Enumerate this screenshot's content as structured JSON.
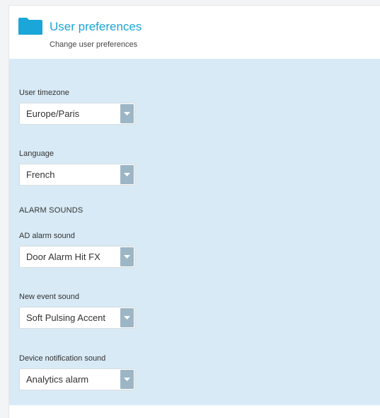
{
  "header": {
    "title": "User preferences",
    "subtitle": "Change user preferences",
    "icon": "folder-icon",
    "accent_color": "#1aa6d8"
  },
  "panel_color": "#d8eaf5",
  "fields": {
    "timezone": {
      "label": "User timezone",
      "value": "Europe/Paris"
    },
    "language": {
      "label": "Language",
      "value": "French"
    },
    "alarm_section": "ALARM SOUNDS",
    "ad_alarm": {
      "label": "AD alarm sound",
      "value": "Door Alarm Hit FX"
    },
    "new_event": {
      "label": "New event sound",
      "value": "Soft Pulsing Accent"
    },
    "device_notification": {
      "label": "Device notification sound",
      "value": "Analytics alarm"
    }
  }
}
